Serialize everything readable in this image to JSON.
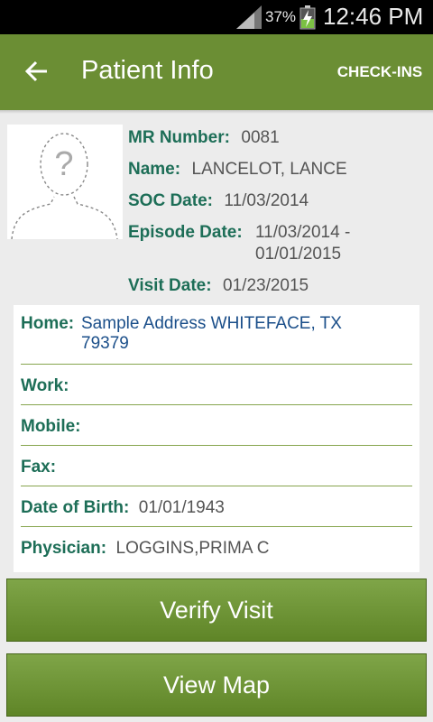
{
  "status_bar": {
    "battery_percent": "37%",
    "time": "12:46 PM"
  },
  "app_bar": {
    "title": "Patient Info",
    "action_label": "CHECK-INS"
  },
  "patient": {
    "mr_number": {
      "label": "MR Number:",
      "value": "0081"
    },
    "name": {
      "label": "Name:",
      "value": "LANCELOT, LANCE"
    },
    "soc_date": {
      "label": "SOC Date:",
      "value": "11/03/2014"
    },
    "episode_date": {
      "label": "Episode Date:",
      "value_line1": "11/03/2014 -",
      "value_line2": "01/01/2015"
    },
    "visit_date": {
      "label": "Visit Date:",
      "value": "01/23/2015"
    }
  },
  "contact": {
    "home": {
      "label": "Home:",
      "value_line1": "Sample Address WHITEFACE, TX",
      "value_line2": "79379"
    },
    "work": {
      "label": "Work:",
      "value": ""
    },
    "mobile": {
      "label": "Mobile:",
      "value": ""
    },
    "fax": {
      "label": "Fax:",
      "value": ""
    },
    "dob": {
      "label": "Date of Birth:",
      "value": "01/01/1943"
    },
    "physician": {
      "label": "Physician:",
      "value": "LOGGINS,PRIMA C"
    }
  },
  "buttons": {
    "verify": "Verify Visit",
    "map": "View Map"
  },
  "colors": {
    "app_bar": "#6b8e34",
    "label_green": "#1d6e57",
    "address_blue": "#1b4f8a",
    "divider": "#86a54e"
  }
}
